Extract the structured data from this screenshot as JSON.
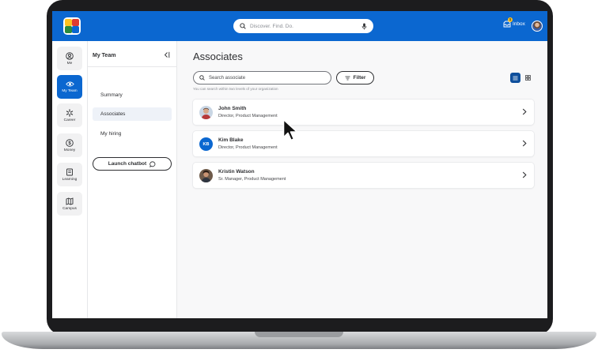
{
  "topbar": {
    "search_placeholder": "Discover. Find. Do.",
    "inbox_label": "Inbox",
    "inbox_count": "1",
    "brand_color": "#0b67d0"
  },
  "rail": {
    "items": [
      {
        "label": "Me",
        "icon": "user-circle-icon",
        "active": false
      },
      {
        "label": "My Team",
        "icon": "team-eye-icon",
        "active": true
      },
      {
        "label": "Career",
        "icon": "spark-icon",
        "active": false
      },
      {
        "label": "Money",
        "icon": "dollar-coin-icon",
        "active": false
      },
      {
        "label": "Learning",
        "icon": "book-icon",
        "active": false
      },
      {
        "label": "Campus",
        "icon": "map-icon",
        "active": false
      }
    ]
  },
  "sidebar": {
    "title": "My Team",
    "items": [
      {
        "label": "Summary",
        "active": false
      },
      {
        "label": "Associates",
        "active": true
      },
      {
        "label": "My hiring",
        "active": false
      }
    ],
    "chatbot_label": "Launch chatbot"
  },
  "main": {
    "title": "Associates",
    "search_placeholder": "Search associate",
    "search_hint": "You can search within two levels of your organization",
    "filter_label": "Filter",
    "view_mode": "list",
    "associates": [
      {
        "name": "John Smith",
        "role": "Director, Product Management",
        "avatar": "photo"
      },
      {
        "name": "Kim Blake",
        "role": "Director, Product Management",
        "avatar": "initials",
        "initials": "KB"
      },
      {
        "name": "Kristin Watson",
        "role": "Sr. Manager, Product Management",
        "avatar": "photo"
      }
    ]
  }
}
